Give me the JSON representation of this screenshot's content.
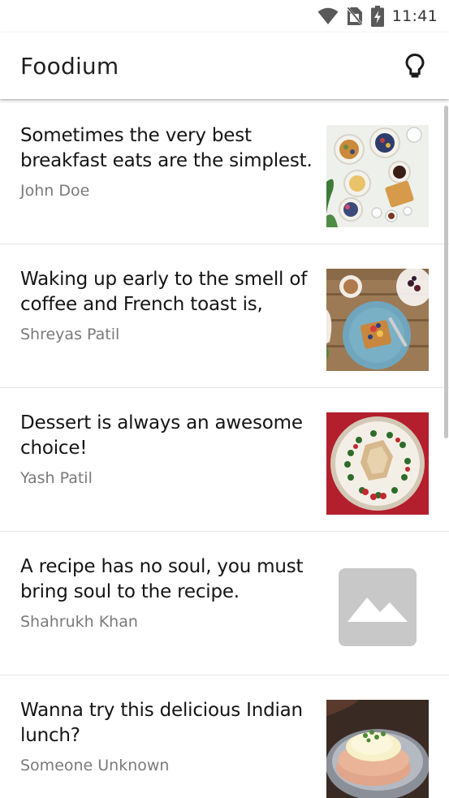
{
  "status_bar": {
    "time": "11:41",
    "icons": [
      "wifi-icon",
      "no-sim-icon",
      "battery-charging-icon"
    ]
  },
  "app_bar": {
    "title": "Foodium",
    "action_icon": "lightbulb-icon"
  },
  "posts": [
    {
      "title": "Sometimes the very best breakfast eats are the simplest.",
      "author": "John Doe",
      "image": "breakfast-table-image"
    },
    {
      "title": "Waking up early to the smell of coffee and French toast is,",
      "author": "Shreyas Patil",
      "image": "french-toast-image"
    },
    {
      "title": "Dessert is always an awesome choice!",
      "author": "Yash Patil",
      "image": "dessert-tart-image"
    },
    {
      "title": "A recipe has no soul, you must bring soul to the recipe.",
      "author": "Shahrukh Khan",
      "image": "placeholder-image-icon"
    },
    {
      "title": "Wanna try this delicious Indian lunch?",
      "author": "Someone Unknown",
      "image": "indian-lunch-image"
    }
  ],
  "colors": {
    "title_text": "#141414",
    "author_text": "#7a7a7a",
    "divider": "#e6e6e6",
    "placeholder": "#c8c8c8"
  }
}
